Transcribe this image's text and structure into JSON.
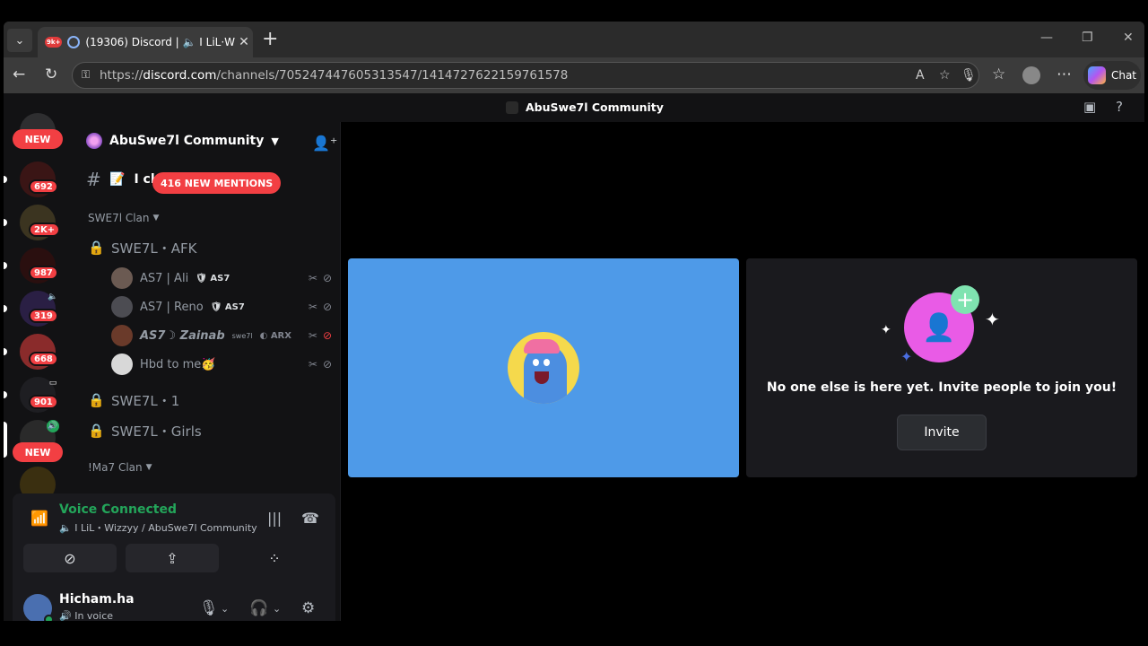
{
  "browser": {
    "tab_badge": "9k+",
    "tab_title": "(19306) Discord | 🔈 Ι LiL·W",
    "tab_close": "✕",
    "new_tab": "+",
    "url_prefix": "https://",
    "url_domain": "discord.com",
    "url_path": "/channels/705247447605313547/1414727622159761578",
    "chat_label": "Chat"
  },
  "discord": {
    "window_title": "AbuSwe7l Community",
    "server_name": "AbuSwe7l Community",
    "channel_partial": "Ι cl",
    "mentions_label": "416 NEW MENTIONS",
    "rail": {
      "new_top": "NEW",
      "new_bottom": "NEW",
      "counts": [
        "692",
        "2K+",
        "987",
        "319",
        "668",
        "901"
      ]
    },
    "categories": {
      "swe7l": "SWE7l Clan",
      "ma7": "!Ma7 Clan"
    },
    "voice_channels": {
      "afk": "SWE7L・AFK",
      "one": "SWE7L・1",
      "girls": "SWE7L・Girls"
    },
    "members": [
      {
        "name": "AS7 | Ali",
        "tag": "AS7"
      },
      {
        "name": "AS7 | Reno",
        "tag": "AS7"
      },
      {
        "name": "AS7☽ Zainab",
        "sup": "swe7l",
        "tag": "ARX"
      },
      {
        "name": "Hbd to me🥳",
        "tag": ""
      }
    ],
    "voice_panel": {
      "status": "Voice Connected",
      "channel": "Ι LiL・Wizzyy / AbuSwe7l Community"
    },
    "user": {
      "name": "Hicham.ha",
      "status": "In voice"
    },
    "invite_tile": {
      "message": "No one else is here yet. Invite people to join you!",
      "button": "Invite"
    },
    "colors": {
      "accent_green": "#23a55a",
      "mention_red": "#f23f43",
      "tile_blue": "#4e9ae8",
      "invite_pink": "#e95be6"
    }
  }
}
